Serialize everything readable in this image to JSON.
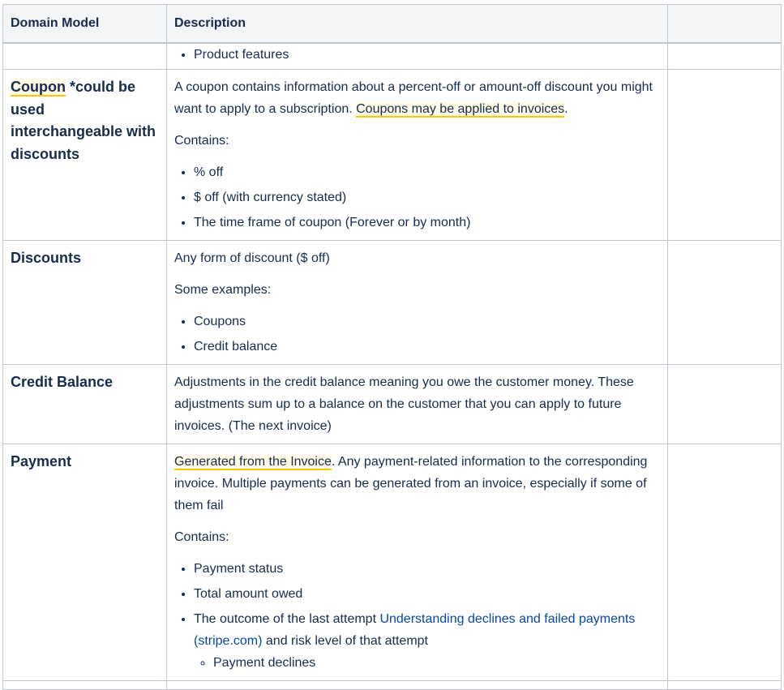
{
  "table": {
    "headers": [
      "Domain Model",
      "Description",
      ""
    ],
    "partial_row": {
      "items": [
        "Product features"
      ]
    },
    "coupon": {
      "name_highlight": "Coupon",
      "name_rest": " *could be used interchangeable with discounts",
      "desc_text": "A coupon contains information about a percent-off or amount-off discount you might want to apply to a subscription. ",
      "desc_highlight": "Coupons may be applied to invoices",
      "desc_end": ".",
      "contains_label": "Contains:",
      "items": [
        "% off",
        "$ off (with currency stated)",
        "The time frame of coupon (Forever or by month)"
      ]
    },
    "discounts": {
      "name": "Discounts",
      "desc": "Any form of discount ($ off)",
      "examples_label": "Some examples:",
      "items": [
        "Coupons",
        "Credit balance"
      ]
    },
    "credit_balance": {
      "name": "Credit Balance",
      "desc": "Adjustments in the credit balance meaning you owe the customer money. These adjustments sum up to a balance on the customer that you can apply to future invoices. (The next invoice)"
    },
    "payment": {
      "name": "Payment",
      "desc_highlight": "Generated from the Invoice",
      "desc_rest": ". Any payment-related information to the corresponding invoice. Multiple payments can be generated from an invoice, especially if some of them fail",
      "contains_label": "Contains:",
      "items": [
        "Payment status",
        "Total amount owed"
      ],
      "outcome_text": "The outcome of the last attempt ",
      "outcome_link": "Understanding declines and failed payments (stripe.com)",
      "outcome_end": " and risk level of that attempt",
      "sub_items": [
        "Payment declines"
      ]
    }
  },
  "colors": {
    "text": "#172b4d",
    "header_bg": "#f4f5f7",
    "border": "#c1c7d0",
    "highlight_bg": "#fffae6",
    "highlight_underline": "#ffc400",
    "link": "#0747a6"
  }
}
